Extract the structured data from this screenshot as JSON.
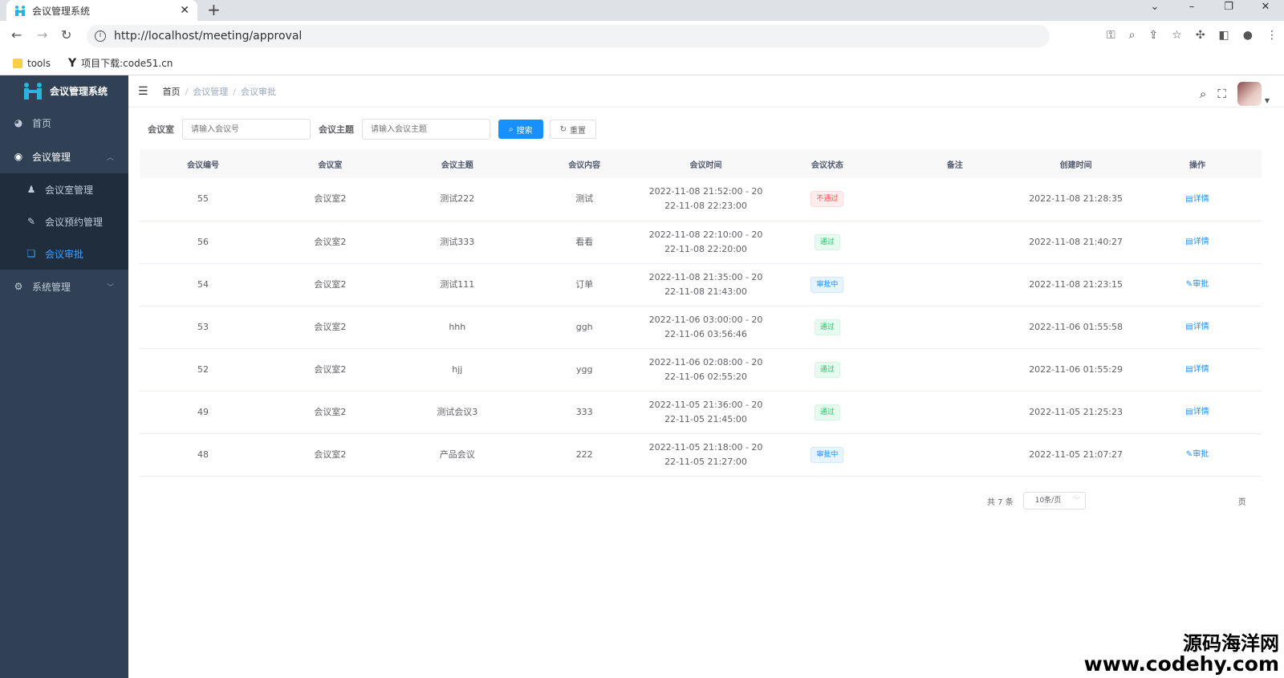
{
  "browser": {
    "tab_title": "会议管理系统",
    "url": "http://localhost/meeting/approval",
    "bookmarks": [
      "tools",
      "项目下载:code51.cn"
    ]
  },
  "sidebar": {
    "brand": "会议管理系统",
    "items": [
      {
        "label": "首页",
        "icon": "dashboard-icon"
      },
      {
        "label": "会议管理",
        "icon": "globe-icon"
      },
      {
        "label": "系统管理",
        "icon": "gear-icon"
      }
    ],
    "sub_items": [
      {
        "label": "会议室管理",
        "icon": "user-icon"
      },
      {
        "label": "会议预约管理",
        "icon": "edit-icon"
      },
      {
        "label": "会议审批",
        "icon": "clipboard-icon"
      }
    ]
  },
  "breadcrumb": [
    "首页",
    "会议管理",
    "会议审批"
  ],
  "search": {
    "room_label": "会议室",
    "room_placeholder": "请输入会议号",
    "topic_label": "会议主题",
    "topic_placeholder": "请输入会议主题",
    "search_button": "搜索",
    "reset_button": "重置"
  },
  "table": {
    "headers": [
      "会议编号",
      "会议室",
      "会议主题",
      "会议内容",
      "会议时间",
      "会议状态",
      "备注",
      "创建时间",
      "操作"
    ],
    "rows": [
      {
        "id": "55",
        "room": "会议室2",
        "topic": "测试222",
        "content": "测试",
        "time1": "2022-11-08 21:52:00 - 20",
        "time2": "22-11-08 22:23:00",
        "status": "不通过",
        "status_type": "danger",
        "remark": "",
        "created": "2022-11-08 21:28:35",
        "op": "详情"
      },
      {
        "id": "56",
        "room": "会议室2",
        "topic": "测试333",
        "content": "看看",
        "time1": "2022-11-08 22:10:00 - 20",
        "time2": "22-11-08 22:20:00",
        "status": "通过",
        "status_type": "success",
        "remark": "",
        "created": "2022-11-08 21:40:27",
        "op": "详情"
      },
      {
        "id": "54",
        "room": "会议室2",
        "topic": "测试111",
        "content": "订单",
        "time1": "2022-11-08 21:35:00 - 20",
        "time2": "22-11-08 21:43:00",
        "status": "审批中",
        "status_type": "info",
        "remark": "",
        "created": "2022-11-08 21:23:15",
        "op": "审批"
      },
      {
        "id": "53",
        "room": "会议室2",
        "topic": "hhh",
        "content": "ggh",
        "time1": "2022-11-06 03:00:00 - 20",
        "time2": "22-11-06 03:56:46",
        "status": "通过",
        "status_type": "success",
        "remark": "",
        "created": "2022-11-06 01:55:58",
        "op": "详情"
      },
      {
        "id": "52",
        "room": "会议室2",
        "topic": "hjj",
        "content": "ygg",
        "time1": "2022-11-06 02:08:00 - 20",
        "time2": "22-11-06 02:55:20",
        "status": "通过",
        "status_type": "success",
        "remark": "",
        "created": "2022-11-06 01:55:29",
        "op": "详情"
      },
      {
        "id": "49",
        "room": "会议室2",
        "topic": "测试会议3",
        "content": "333",
        "time1": "2022-11-05 21:36:00 - 20",
        "time2": "22-11-05 21:45:00",
        "status": "通过",
        "status_type": "success",
        "remark": "",
        "created": "2022-11-05 21:25:23",
        "op": "详情"
      },
      {
        "id": "48",
        "room": "会议室2",
        "topic": "产品会议",
        "content": "222",
        "time1": "2022-11-05 21:18:00 - 20",
        "time2": "22-11-05 21:27:00",
        "status": "审批中",
        "status_type": "info",
        "remark": "",
        "created": "2022-11-05 21:07:27",
        "op": "审批"
      }
    ]
  },
  "pagination": {
    "total": "共 7 条",
    "page_size": "10条/页",
    "page_word": "页"
  },
  "watermark": {
    "line1": "源码海洋网",
    "line2": "www.codehy.com"
  },
  "colors": {
    "sidebar_bg": "#304156",
    "submenu_bg": "#1f2d3d",
    "primary": "#1890ff",
    "active_menu": "#409eff"
  }
}
